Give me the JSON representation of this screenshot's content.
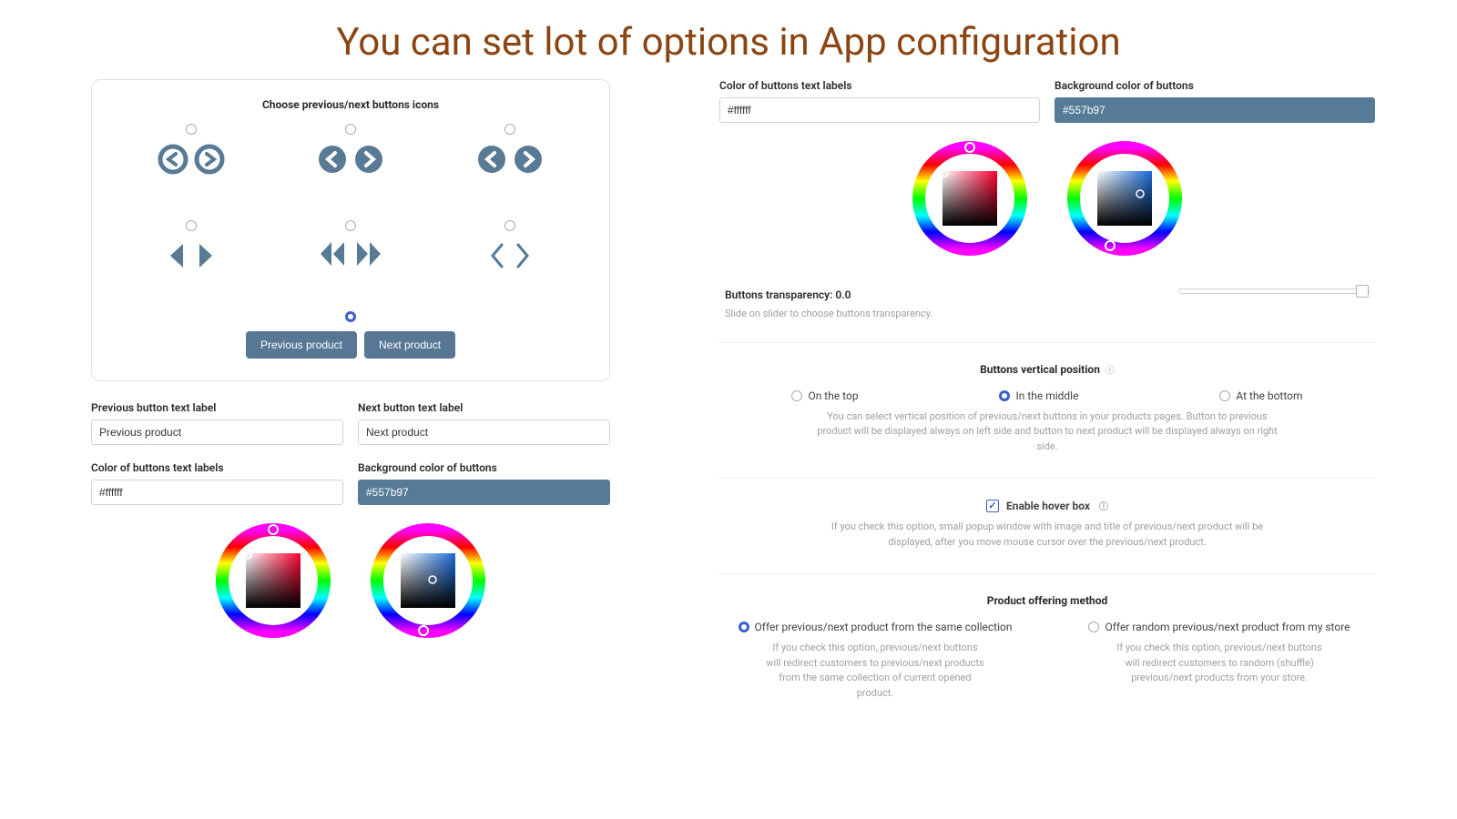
{
  "title": "You can set lot of options in App configuration",
  "left": {
    "card_title": "Choose previous/next buttons icons",
    "prev_button_label": "Previous product",
    "next_button_label": "Next product",
    "labels": {
      "prev_label_title": "Previous button text label",
      "next_label_title": "Next button text label",
      "prev_value": "Previous product",
      "next_value": "Next product",
      "text_color_title": "Color of buttons text labels",
      "bg_color_title": "Background color of buttons",
      "text_color_value": "#ffffff",
      "bg_color_value": "#557b97"
    }
  },
  "right": {
    "text_color_title": "Color of buttons text labels",
    "bg_color_title": "Background color of buttons",
    "text_color_value": "#ffffff",
    "bg_color_value": "#557b97",
    "transparency_title": "Buttons transparency: 0.0",
    "transparency_help": "Slide on slider to choose buttons transparency.",
    "vpos_title": "Buttons vertical position",
    "vpos_options": {
      "top": "On the top",
      "middle": "In the middle",
      "bottom": "At the bottom"
    },
    "vpos_help": "You can select vertical position of previous/next buttons in your products pages. Button to previous product will be displayed always on left side and button to next product will be displayed always on right side.",
    "hover_title": "Enable hover box",
    "hover_help": "If you check this option, small popup window with image and title of previous/next product will be displayed, after you move mouse cursor over the previous/next product.",
    "offer_title": "Product offering method",
    "offer_same_label": "Offer previous/next product from the same collection",
    "offer_same_help": "If you check this option, previous/next buttons will redirect customers to previous/next products from the same collection of current opened product.",
    "offer_random_label": "Offer random previous/next product from my store",
    "offer_random_help": "If you check this option, previous/next buttons will redirect customers to random (shuffle) previous/next products from your store."
  },
  "colors": {
    "accent": "#597a94"
  }
}
